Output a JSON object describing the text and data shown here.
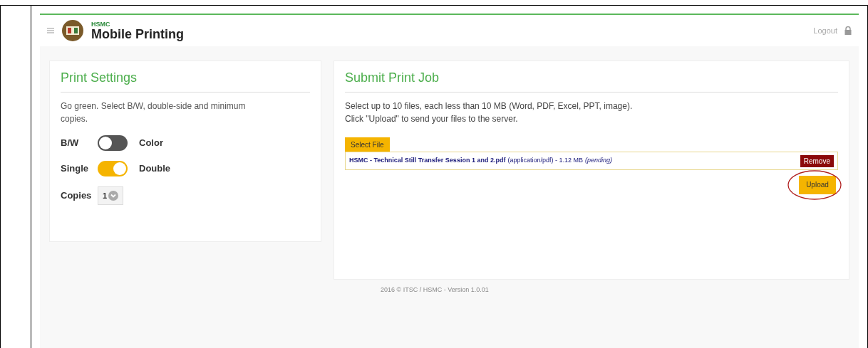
{
  "header": {
    "brand_small": "HSMC",
    "brand": "Mobile Printing",
    "logout": "Logout"
  },
  "print_settings": {
    "title": "Print Settings",
    "description": "Go green. Select B/W, double-side and minimum copies.",
    "toggles": [
      {
        "left": "B/W",
        "right": "Color",
        "on": false
      },
      {
        "left": "Single",
        "right": "Double",
        "on": true
      }
    ],
    "copies": {
      "label": "Copies",
      "value": "1"
    }
  },
  "submit": {
    "title": "Submit Print Job",
    "lines": [
      "Select up to 10 files, each less than 10 MB (Word, PDF, Excel, PPT, image).",
      "Click \"Upload\" to send your files to the server."
    ],
    "select_button": "Select File",
    "files": [
      {
        "name": "HSMC - Technical Still Transfer Session 1 and 2.pdf",
        "info": "(application/pdf) - 1.12 MB",
        "status": "(pending)",
        "remove": "Remove"
      }
    ],
    "upload_button": "Upload",
    "upload_highlighted": true
  },
  "footer": "2016 © ITSC / HSMC - Version 1.0.01"
}
